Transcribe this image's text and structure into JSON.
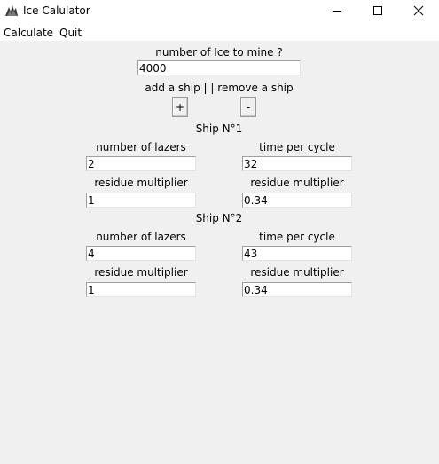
{
  "window": {
    "title": "Ice Calulator",
    "icon": "feather-tk-icon",
    "controls": [
      "minimize-icon",
      "maximize-icon",
      "close-icon"
    ]
  },
  "menu": {
    "calculate": "Calculate",
    "quit": "Quit"
  },
  "ice": {
    "label": "number of Ice to mine ?",
    "value": "4000"
  },
  "ship_controls": {
    "label": "add a ship |  | remove a ship",
    "add": "+",
    "remove": "-"
  },
  "ships": [
    {
      "title": "Ship N°1",
      "lazers_label": "number of lazers",
      "lazers": "2",
      "cycle_label": "time per cycle",
      "cycle": "32",
      "residue_left_label": "residue multiplier",
      "residue_left": "1",
      "residue_right_label": "residue multiplier",
      "residue_right": "0.34"
    },
    {
      "title": "Ship N°2",
      "lazers_label": "number of lazers",
      "lazers": "4",
      "cycle_label": "time per cycle",
      "cycle": "43",
      "residue_left_label": "residue multiplier",
      "residue_left": "1",
      "residue_right_label": "residue multiplier",
      "residue_right": "0.34"
    }
  ]
}
